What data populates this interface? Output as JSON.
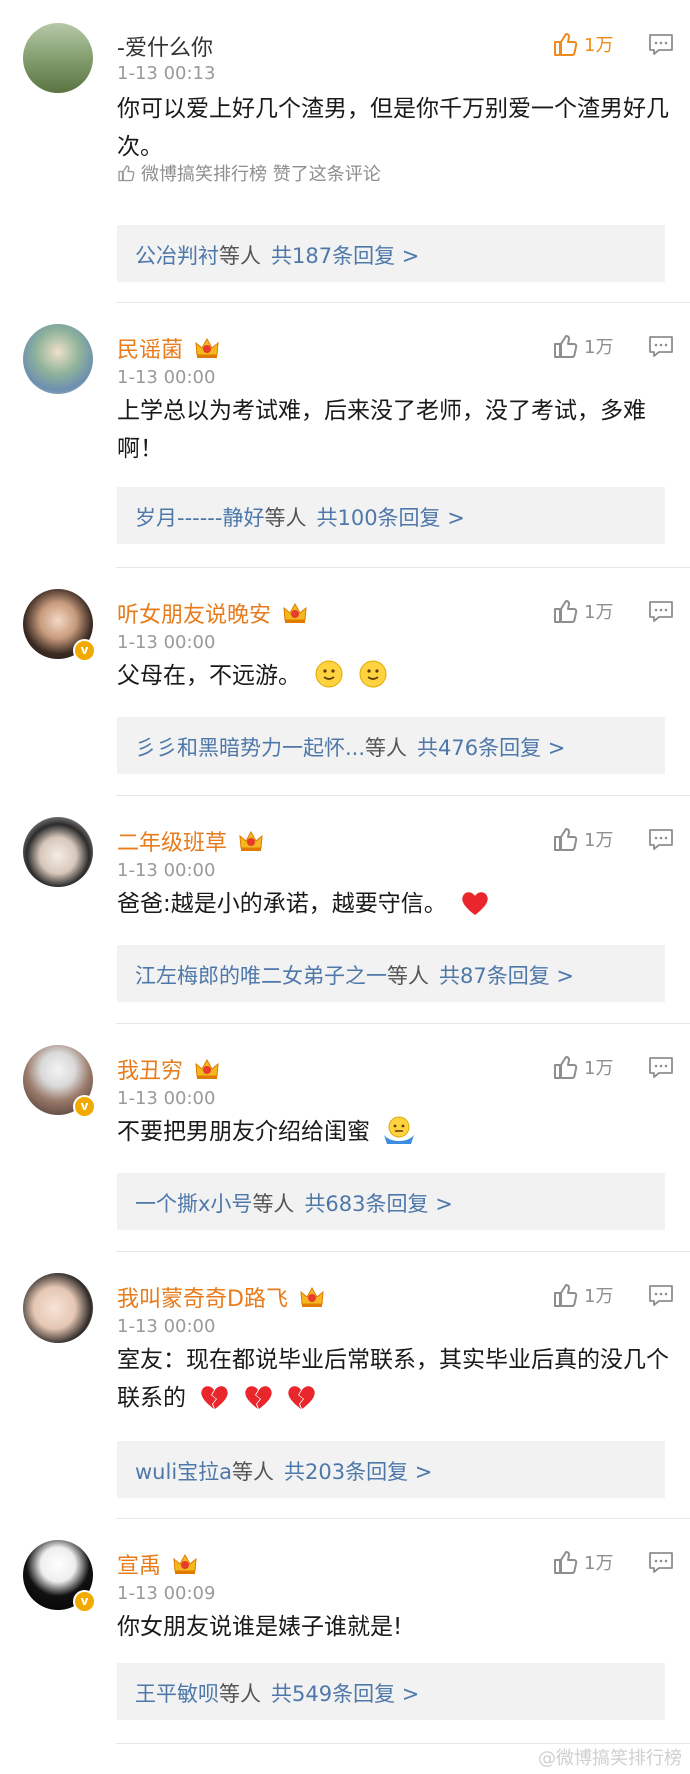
{
  "comments": [
    {
      "name": "-爱什么你",
      "time": "1-13 00:13",
      "text": "你可以爱上好几个渣男，但是你千万别爱一个渣男好几次。",
      "likes": "1万",
      "liked_by": "微博搞笑排行榜 赞了这条评论",
      "reply_user": "公冶判衬",
      "reply_mid": "等人",
      "reply_count": "共187条回复 >"
    },
    {
      "name": "民谣菌",
      "time": "1-13 00:00",
      "text": "上学总以为考试难，后来没了老师，没了考试，多难啊！",
      "likes": "1万",
      "reply_user": "岁月------静好",
      "reply_mid": "等人",
      "reply_count": "共100条回复 >"
    },
    {
      "name": "听女朋友说晚安",
      "time": "1-13 00:00",
      "text": "父母在，不远游。",
      "likes": "1万",
      "reply_user": "彡彡和黑暗势力一起怀...",
      "reply_mid": "等人",
      "reply_count": "共476条回复 >"
    },
    {
      "name": "二年级班草",
      "time": "1-13 00:00",
      "text": "爸爸:越是小的承诺，越要守信。",
      "likes": "1万",
      "reply_user": "江左梅郎的唯二女弟子之一",
      "reply_mid": "等人",
      "reply_count": "共87条回复 >"
    },
    {
      "name": "我丑穷",
      "time": "1-13 00:00",
      "text": "不要把男朋友介绍给闺蜜",
      "likes": "1万",
      "reply_user": "一个撕x小号",
      "reply_mid": "等人",
      "reply_count": "共683条回复 >"
    },
    {
      "name": "我叫蒙奇奇D路飞",
      "time": "1-13 00:00",
      "text": "室友：现在都说毕业后常联系，其实毕业后真的没几个联系的",
      "likes": "1万",
      "reply_user": "wuli宝拉a",
      "reply_mid": "等人",
      "reply_count": "共203条回复 >"
    },
    {
      "name": "宣禹",
      "time": "1-13 00:09",
      "text": "你女朋友说谁是婊子谁就是!",
      "likes": "1万",
      "reply_user": "王平敏呗",
      "reply_mid": "等人",
      "reply_count": "共549条回复 >"
    }
  ],
  "watermark": "@微博搞笑排行榜",
  "colors": {
    "name_vip": "#e87b1b",
    "reply_link": "#4e78aa",
    "like_active": "#f08a1a"
  }
}
